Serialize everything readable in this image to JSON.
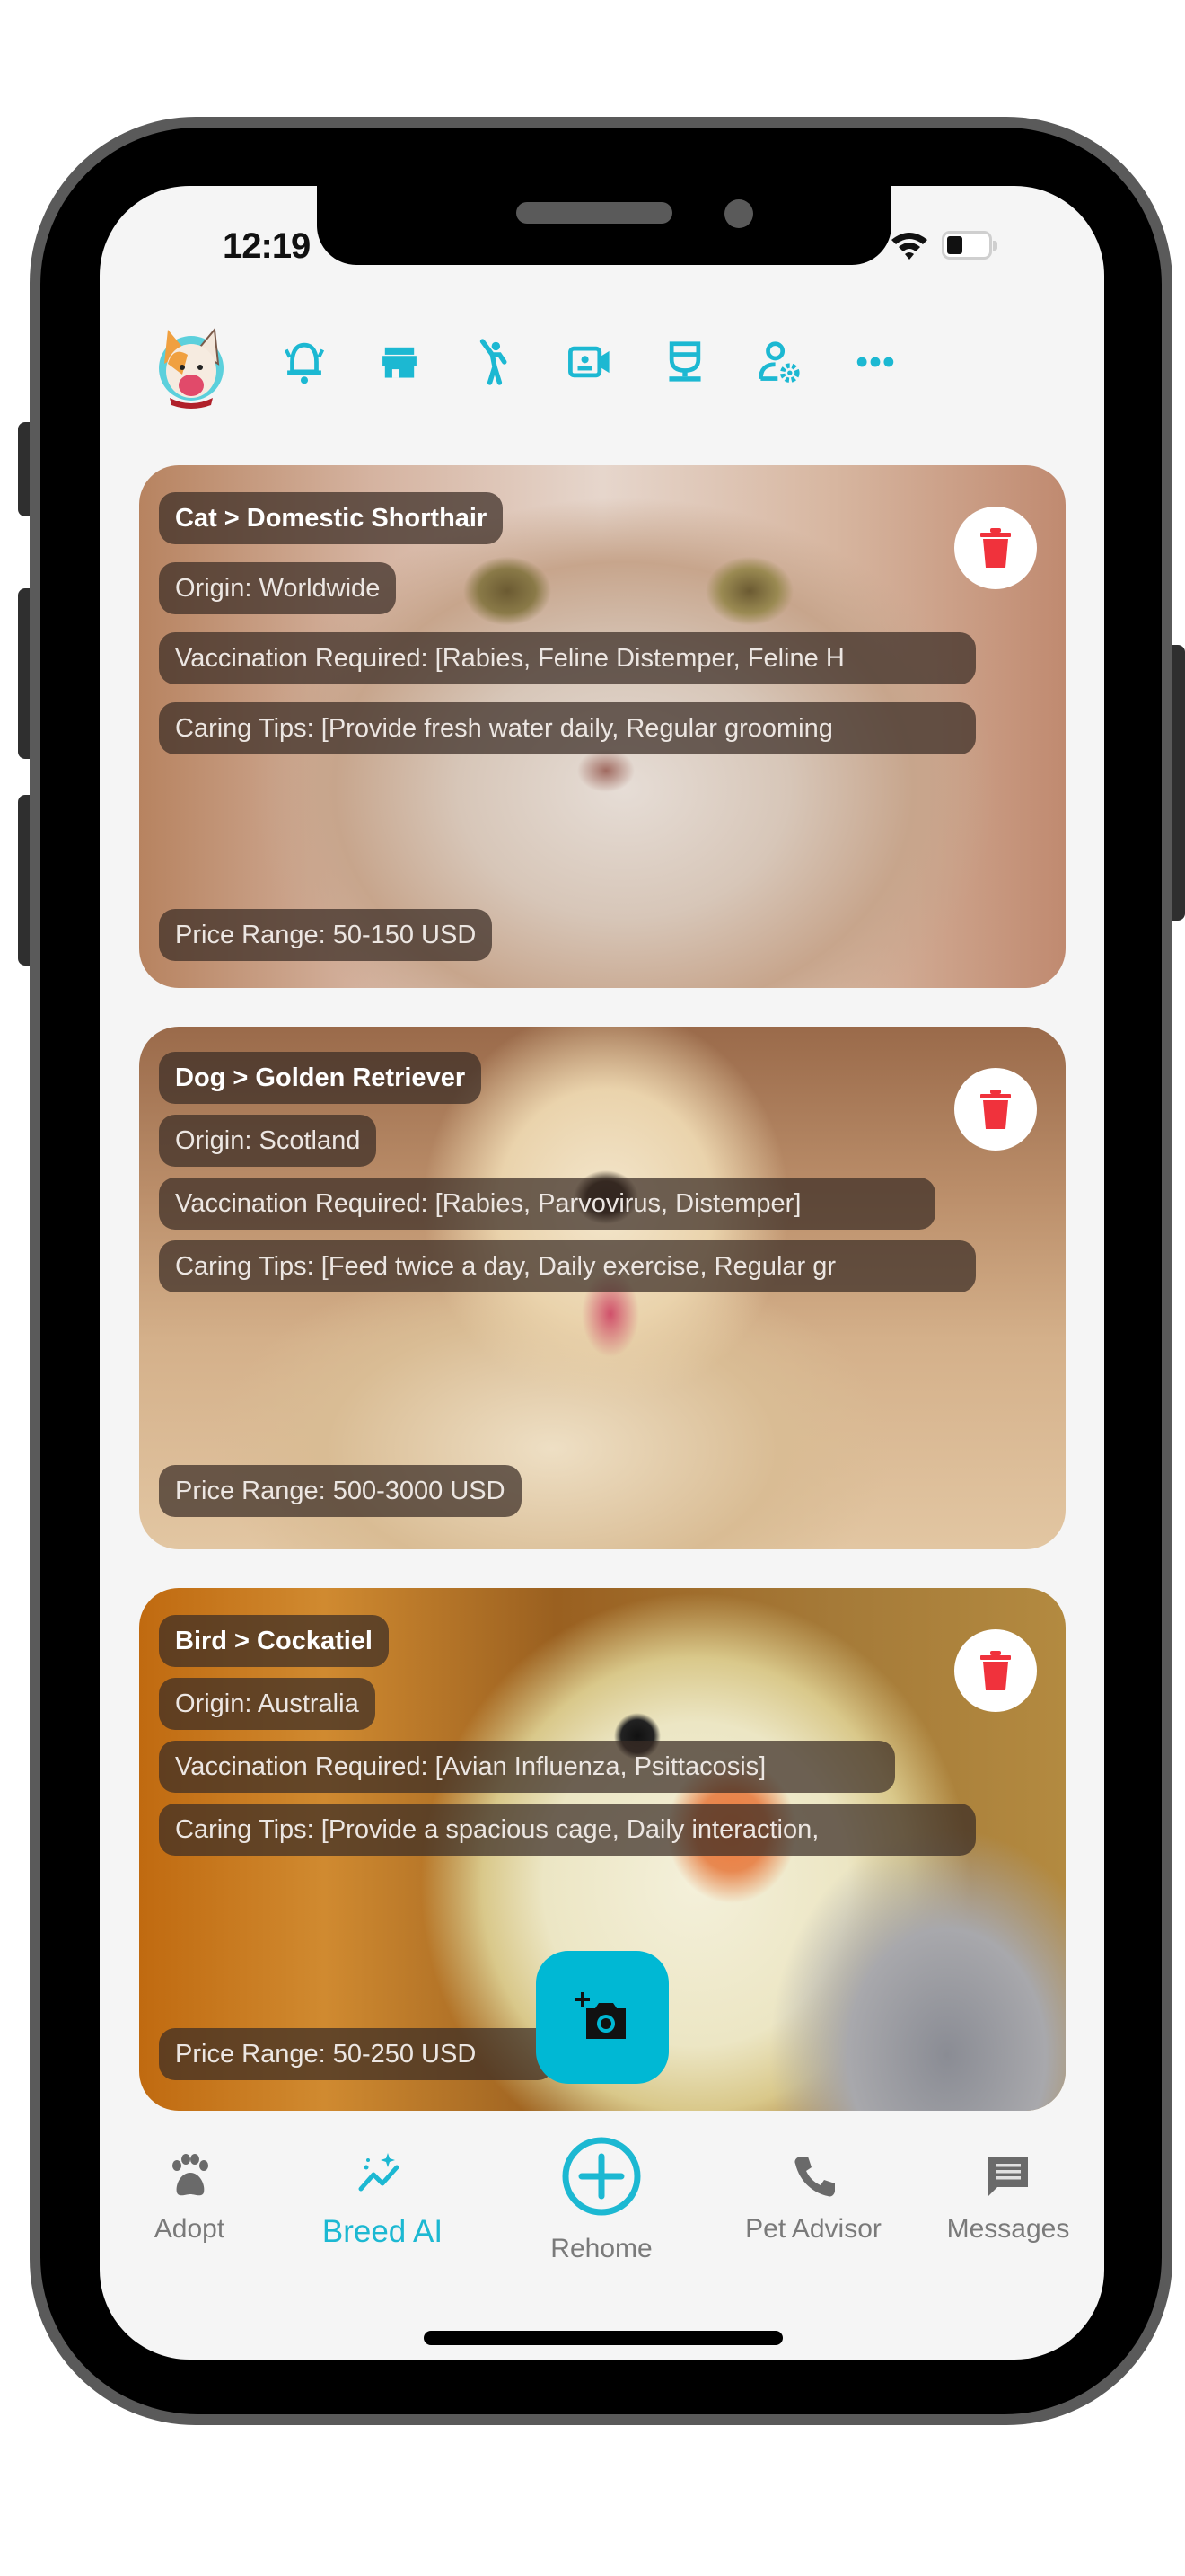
{
  "status_bar": {
    "time": "12:19",
    "wifi_icon": "wifi-icon",
    "battery_icon": "battery-icon"
  },
  "colors": {
    "accent": "#1cb8d2",
    "fab": "#00b8d4",
    "delete": "#f0323c",
    "inactive": "#7a7a7a",
    "screen_bg": "#f5f5f5"
  },
  "top_bar": {
    "avatar": "french-bulldog-logo",
    "icons": [
      {
        "name": "alarm-bell-icon"
      },
      {
        "name": "store-icon"
      },
      {
        "name": "person-waving-icon"
      },
      {
        "name": "video-contact-icon"
      },
      {
        "name": "coffee-cup-icon"
      },
      {
        "name": "user-settings-icon"
      },
      {
        "name": "more-dots-icon"
      }
    ]
  },
  "cards": [
    {
      "title": "Cat > Domestic Shorthair",
      "origin": "Origin: Worldwide",
      "vaccination": "Vaccination Required: [Rabies, Feline Distemper, Feline H",
      "caring_tips": "Caring Tips: [Provide fresh water daily, Regular grooming",
      "price": "Price Range: 50-150 USD",
      "image": "cat-photo"
    },
    {
      "title": "Dog > Golden Retriever",
      "origin": "Origin: Scotland",
      "vaccination": "Vaccination Required: [Rabies, Parvovirus, Distemper]",
      "caring_tips": "Caring Tips: [Feed twice a day, Daily exercise, Regular gr",
      "price": "Price Range: 500-3000 USD",
      "image": "dog-photo"
    },
    {
      "title": "Bird > Cockatiel",
      "origin": "Origin: Australia",
      "vaccination": "Vaccination Required: [Avian Influenza, Psittacosis]",
      "caring_tips": "Caring Tips: [Provide a spacious cage, Daily interaction,",
      "price": "Price Range: 50-250 USD",
      "image": "bird-photo"
    }
  ],
  "fab": {
    "icon": "add-photo-camera-icon"
  },
  "bottom_nav": {
    "items": [
      {
        "label": "Adopt",
        "icon": "paw-icon",
        "active": false
      },
      {
        "label": "Breed AI",
        "icon": "sparkle-chart-icon",
        "active": true
      },
      {
        "label": "Rehome",
        "icon": "plus-circle-icon",
        "active": false
      },
      {
        "label": "Pet Advisor",
        "icon": "phone-icon",
        "active": false
      },
      {
        "label": "Messages",
        "icon": "message-icon",
        "active": false
      }
    ]
  }
}
